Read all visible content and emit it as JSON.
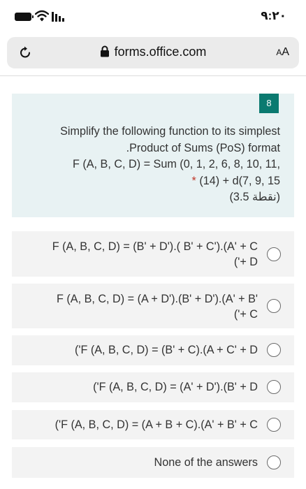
{
  "status_bar": {
    "time": "٩:٢٠",
    "icons": [
      "battery-icon",
      "wifi-icon",
      "signal-icon"
    ]
  },
  "browser": {
    "url": "forms.office.com",
    "text_size_button": {
      "large": "A",
      "small": "A"
    },
    "icons": [
      "reload-icon",
      "lock-icon"
    ]
  },
  "question": {
    "number": "8",
    "lines": [
      "Simplify the following function to its simplest",
      ".Product of Sums (PoS) format",
      "F (A, B, C, D) = Sum (0, 1, 2, 6, 8, 10, 11,",
      "(14) + d(7, 9, 15"
    ],
    "required_mark": "*",
    "points": "(3.5 نقطة)"
  },
  "options": [
    {
      "lines": [
        "F (A, B, C, D) = (B' + D').( B' + C').(A' + C",
        "('+ D"
      ]
    },
    {
      "lines": [
        "F (A, B, C, D) = (A + D').(B' + D').(A' + B'",
        "('+ C"
      ]
    },
    {
      "lines": [
        "('F (A, B, C, D) = (B' + C).(A + C' + D"
      ]
    },
    {
      "lines": [
        "('F (A, B, C, D) = (A' + D').(B' + D"
      ]
    },
    {
      "lines": [
        "('F (A, B, C, D) = (A + B + C).(A' + B' + C"
      ]
    },
    {
      "lines": [
        "None of the answers"
      ]
    }
  ],
  "colors": {
    "accent": "#0b7a70",
    "question_background": "#e8f2f3",
    "option_background": "#f3f3f3",
    "required": "#c0392b"
  }
}
